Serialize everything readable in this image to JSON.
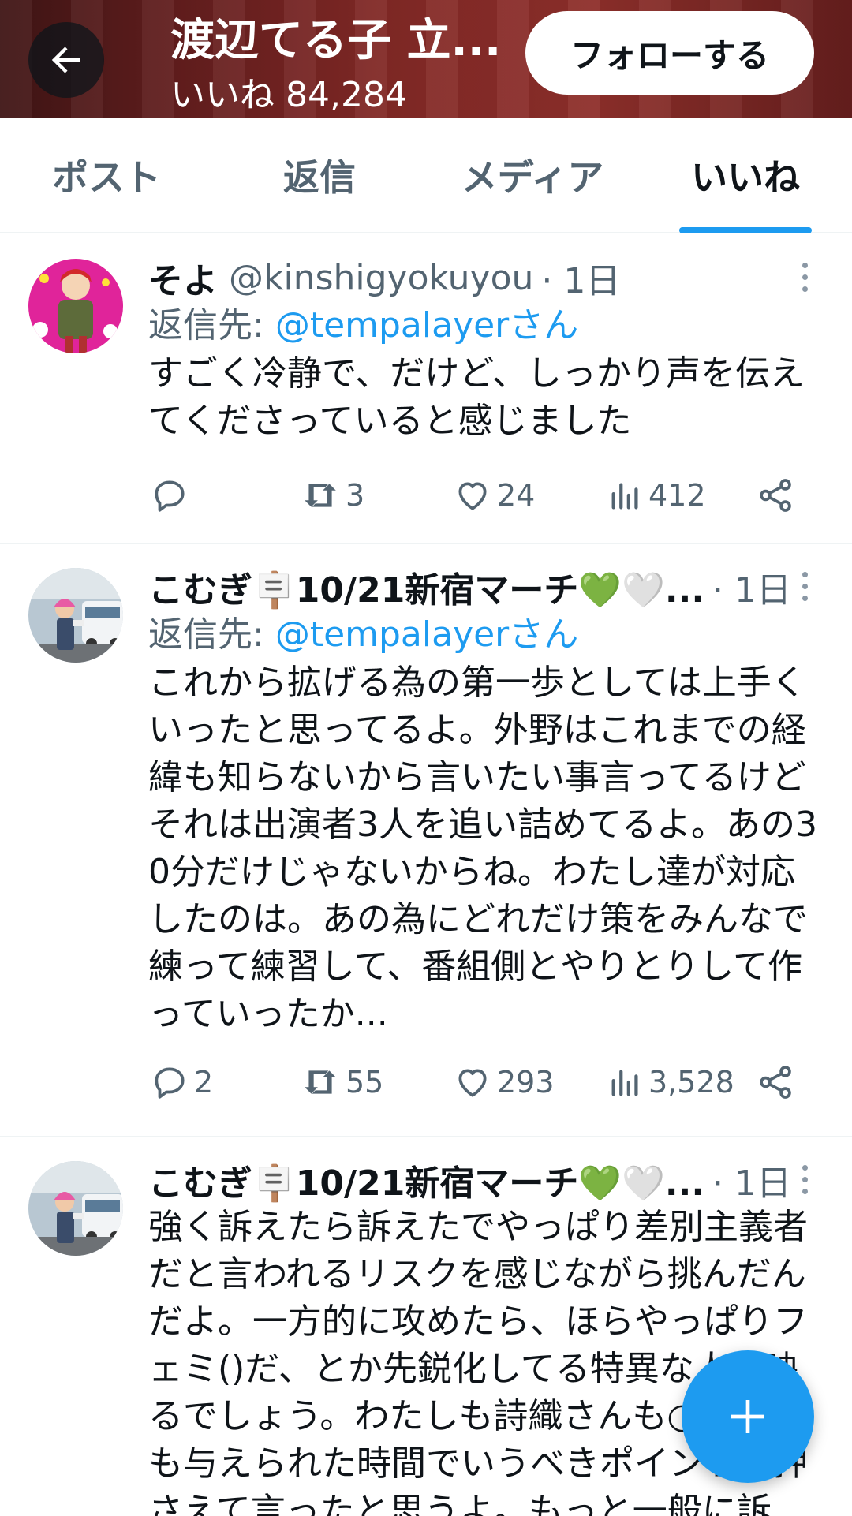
{
  "header": {
    "title": "渡辺てる子 立...",
    "subtitle": "いいね 84,284",
    "follow_label": "フォローする"
  },
  "tabs": [
    {
      "label": "ポスト",
      "active": false
    },
    {
      "label": "返信",
      "active": false
    },
    {
      "label": "メディア",
      "active": false
    },
    {
      "label": "いいね",
      "active": true
    }
  ],
  "tweets": [
    {
      "author": "そよ",
      "handle": "@kinshigyokuyou",
      "time": "· 1日",
      "reply_prefix": "返信先: ",
      "reply_to": "@tempalayerさん",
      "text": "すごく冷静で、だけど、しっかり声を伝えてくださっていると感じました",
      "replies": "",
      "retweets": "3",
      "likes": "24",
      "views": "412"
    },
    {
      "author": "こむぎ🪧10/21新宿マーチ💚🤍...",
      "handle": "",
      "time": "· 1日",
      "reply_prefix": "返信先: ",
      "reply_to": "@tempalayerさん",
      "text": "これから拡げる為の第一歩としては上手くいったと思ってるよ。外野はこれまでの経緯も知らないから言いたい事言ってるけどそれは出演者3人を追い詰めてるよ。あの30分だけじゃないからね。わたし達が対応したのは。あの為にどれだけ策をみんなで練って練習して、番組側とやりとりして作っていったか...",
      "replies": "2",
      "retweets": "55",
      "likes": "293",
      "views": "3,528"
    },
    {
      "author": "こむぎ🪧10/21新宿マーチ💚🤍...",
      "handle": "",
      "time": "· 1日",
      "text": "強く訴えたら訴えたでやっぱり差別主義者だと言われるリスクを感じながら挑んだんだよ。一方的に攻めたら、ほらやっぱりフェミ()だ、とか先鋭化してる特異な人と映るでしょう。わたしも詩織さんも○○さんも与えられた時間でいうべきポイントは押さえて言ったと思うよ。もっと一般に訴"
    }
  ],
  "colors": {
    "accent": "#1d9bf0",
    "text_primary": "#0f1419",
    "text_secondary": "#536471",
    "divider": "#eff3f4"
  },
  "icons": [
    "back-arrow-icon",
    "reply-icon",
    "retweet-icon",
    "heart-icon",
    "views-icon",
    "share-icon",
    "more-icon",
    "compose-plus-icon"
  ]
}
